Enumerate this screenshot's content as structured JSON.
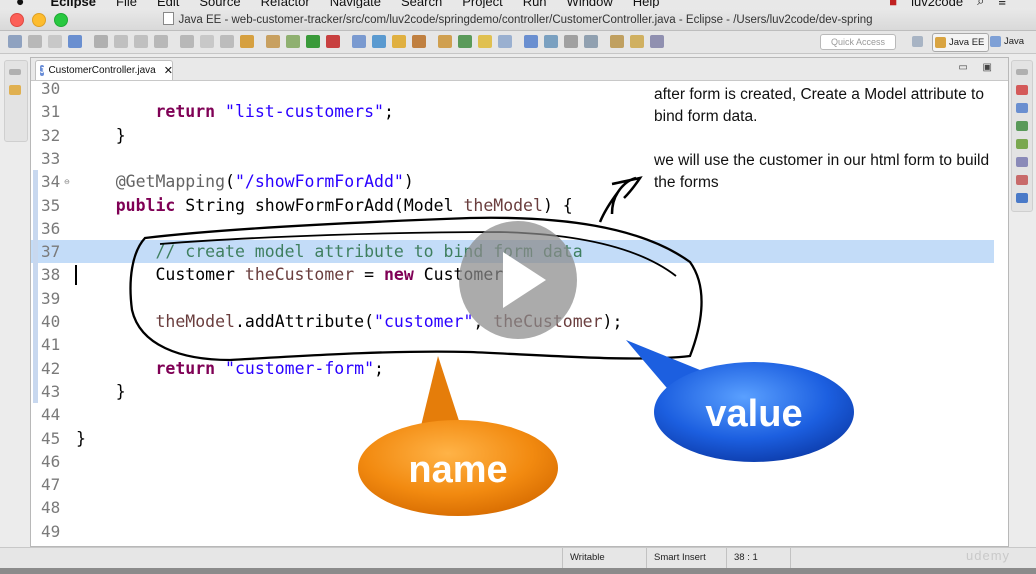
{
  "os_menubar": {
    "app_name": "Eclipse",
    "items": [
      "File",
      "Edit",
      "Source",
      "Refactor",
      "Navigate",
      "Search",
      "Project",
      "Run",
      "Window",
      "Help"
    ],
    "user": "luv2code"
  },
  "window": {
    "title": "Java EE - web-customer-tracker/src/com/luv2code/springdemo/controller/CustomerController.java - Eclipse - /Users/luv2code/dev-spring"
  },
  "toolbar": {
    "quick_access_placeholder": "Quick Access",
    "perspectives": [
      "Java EE",
      "Java"
    ]
  },
  "editor": {
    "tab_label": "CustomerController.java",
    "close_glyph": "✕",
    "lines": [
      {
        "n": "30",
        "code": ""
      },
      {
        "n": "31",
        "code": "        return \"list-customers\";"
      },
      {
        "n": "32",
        "code": "    }"
      },
      {
        "n": "33",
        "code": ""
      },
      {
        "n": "34",
        "code": "    @GetMapping(\"/showFormForAdd\")"
      },
      {
        "n": "35",
        "code": "    public String showFormForAdd(Model theModel) {"
      },
      {
        "n": "36",
        "code": ""
      },
      {
        "n": "37",
        "code": "        // create model attribute to bind form data"
      },
      {
        "n": "38",
        "code": "        Customer theCustomer = new Customer();"
      },
      {
        "n": "39",
        "code": ""
      },
      {
        "n": "40",
        "code": "        theModel.addAttribute(\"customer\", theCustomer);"
      },
      {
        "n": "41",
        "code": ""
      },
      {
        "n": "42",
        "code": "        return \"customer-form\";"
      },
      {
        "n": "43",
        "code": "    }"
      },
      {
        "n": "44",
        "code": ""
      },
      {
        "n": "45",
        "code": "}"
      },
      {
        "n": "46",
        "code": ""
      },
      {
        "n": "47",
        "code": ""
      },
      {
        "n": "48",
        "code": ""
      },
      {
        "n": "49",
        "code": ""
      }
    ]
  },
  "annotations": {
    "note1_line1": "after form is created, Create a Model attribute to",
    "note1_line2": "bind form data.",
    "note2_line1": "we will use the customer in our html form to build",
    "note2_line2": "the forms",
    "bubble_name": "name",
    "bubble_value": "value"
  },
  "status_bar": {
    "writable": "Writable",
    "insert_mode": "Smart Insert",
    "position": "38 : 1"
  },
  "watermark": "udemy",
  "colors": {
    "keyword": "#7f0055",
    "string": "#2a00ff",
    "comment": "#3f7f5f",
    "line_highlight": "#c3dcf8",
    "bubble_name": "#f08a12",
    "bubble_value": "#1a5fe0"
  }
}
